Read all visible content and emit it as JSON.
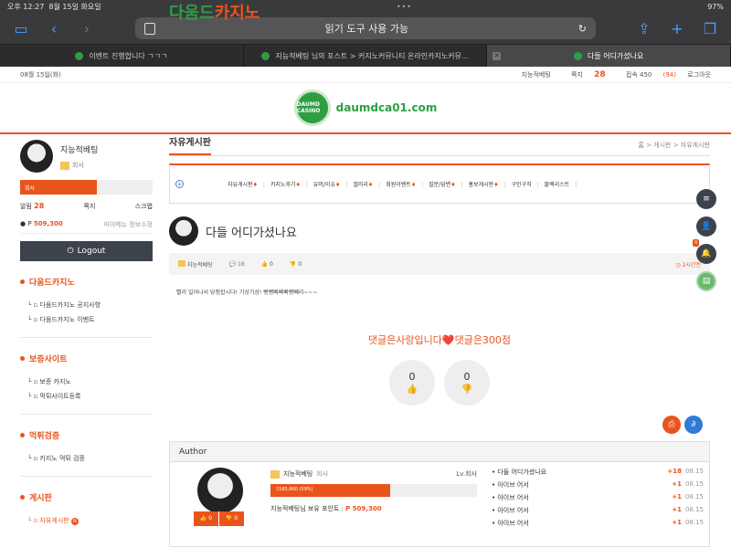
{
  "status": {
    "time": "오후 12:27",
    "date": "8월 15일 화요일",
    "battery": "97%",
    "dots": "•••"
  },
  "browser": {
    "address": "읽기 도구 사용 가능",
    "tabs": [
      {
        "label": "이벤트 진행합니다 ㄱㄱㄱ"
      },
      {
        "label": "지능적베팅 님의 포스트 > 커지노커뮤니티 온라인카지노커뮤..."
      },
      {
        "label": "다들 어디가셨나요"
      }
    ]
  },
  "topline": {
    "date": "08월 15일(화)",
    "user": "지능적베팅",
    "memo_label": "쪽지",
    "memo_count": "28",
    "online_label": "접속 450",
    "online_extra": "(94)",
    "logout": "로그아웃"
  },
  "logo": {
    "badge": "DAUMD CASINO",
    "name_a": "다움드",
    "name_b": "카지노",
    "url": "daumdca01.com"
  },
  "sidebar": {
    "name": "지능적베팅",
    "level": "회사",
    "bar": "회사",
    "alarm_label": "알림",
    "alarm_count": "28",
    "memo": "쪽지",
    "scrap": "스크랩",
    "point_prefix": "P",
    "points": "509,300",
    "links": "마이메뉴   정보수정",
    "logout": "Logout",
    "sections": [
      {
        "title": "다움드카지노",
        "items": [
          "다움드카지노 공지사항",
          "다움드카지노 이벤트"
        ]
      },
      {
        "title": "보증사이트",
        "items": [
          "보증 카지노",
          "먹튀사이트등록"
        ]
      },
      {
        "title": "먹튀검증",
        "items": [
          "카지노 먹튀 검증"
        ]
      },
      {
        "title": "게시판",
        "items": [
          "자유게시판",
          "..."
        ]
      }
    ]
  },
  "board": {
    "title": "자유게시판",
    "crumb": "홈 > 게시판 > 자유게시판",
    "categories": [
      "자유게시판",
      "카지노후기",
      "유머/이슈",
      "갤러리",
      "회원이벤트",
      "질문/답변",
      "홍보게시판",
      "구인구직",
      "블랙리스트"
    ]
  },
  "post": {
    "title": "다들 어디가셨나요",
    "author": "지능적베팅",
    "comments": "18",
    "likes": "0",
    "dislikes": "0",
    "time": "2시간전",
    "body": "빨리 일어나서 당첨합시다! 기상기상! 뻥뻥빠빠빠빵뻬리~~~",
    "notice": "댓글은사랑입니다❤️댓글은300점",
    "up": "0",
    "down": "0"
  },
  "author_box": {
    "title": "Author",
    "name": "지능적베팅",
    "rank": "회사",
    "level": "Lv.회사",
    "exp": "1585,660 (59%)",
    "points_label": "지능적베팅님 보유 포인트 :",
    "points": "P 509,300",
    "btn_up": "0",
    "btn_down": "0",
    "recent": [
      {
        "title": "다들 어디가셨나요",
        "plus": "+18",
        "date": "08.15"
      },
      {
        "title": "아이브 어서",
        "plus": "+1",
        "date": "08.15"
      },
      {
        "title": "아이브 어서",
        "plus": "+1",
        "date": "08.15"
      },
      {
        "title": "아이브 어서",
        "plus": "+1",
        "date": "08.15"
      },
      {
        "title": "아이브 어서",
        "plus": "+1",
        "date": "08.15"
      }
    ]
  },
  "floaters": {
    "count": "0"
  }
}
